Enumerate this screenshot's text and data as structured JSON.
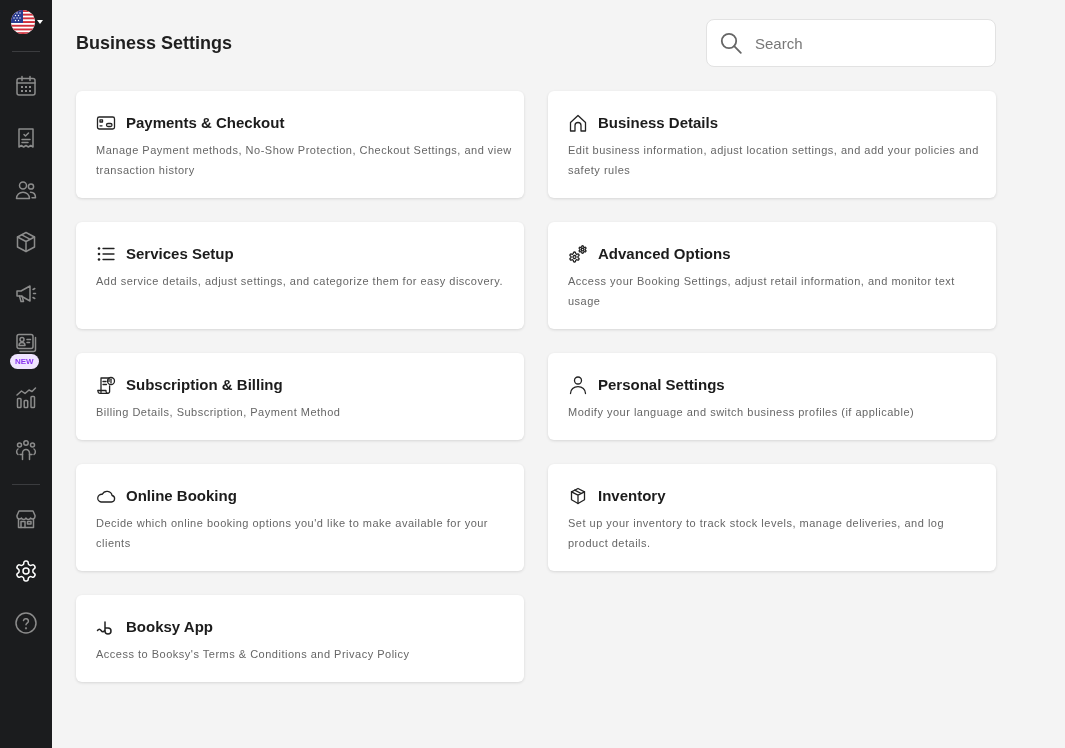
{
  "sidebar": {
    "nav_groups": [
      {
        "items": [
          {
            "selected": false
          },
          {
            "selected": false
          },
          {
            "selected": false
          },
          {
            "selected": false
          },
          {
            "selected": false
          },
          {
            "selected": false,
            "badge": "NEW"
          },
          {
            "selected": false
          },
          {
            "selected": false
          }
        ]
      },
      {
        "items": [
          {
            "selected": false
          },
          {
            "selected": true
          },
          {
            "selected": false
          }
        ]
      }
    ]
  },
  "header": {
    "title": "Business Settings",
    "search": {
      "placeholder": "Search"
    }
  },
  "cards": [
    {
      "title": "Payments & Checkout",
      "description": "Manage Payment methods, No-Show Protection, Checkout Settings, and view transaction history"
    },
    {
      "title": "Business Details",
      "description": "Edit business information, adjust location settings, and add your policies and safety rules"
    },
    {
      "title": "Services Setup",
      "description": "Add service details, adjust settings, and categorize them for easy discovery."
    },
    {
      "title": "Advanced Options",
      "description": "Access your Booking Settings, adjust retail information, and monitor text usage"
    },
    {
      "title": "Subscription & Billing",
      "description": "Billing Details, Subscription, Payment Method"
    },
    {
      "title": "Personal Settings",
      "description": "Modify your language and switch business profiles (if applicable)"
    },
    {
      "title": "Online Booking",
      "description": "Decide which online booking options you'd like to make available for your clients"
    },
    {
      "title": "Inventory",
      "description": "Set up your inventory to track stock levels, manage deliveries, and log product details."
    },
    {
      "title": "Booksy App",
      "description": "Access to Booksy's Terms & Conditions and Privacy Policy"
    }
  ]
}
